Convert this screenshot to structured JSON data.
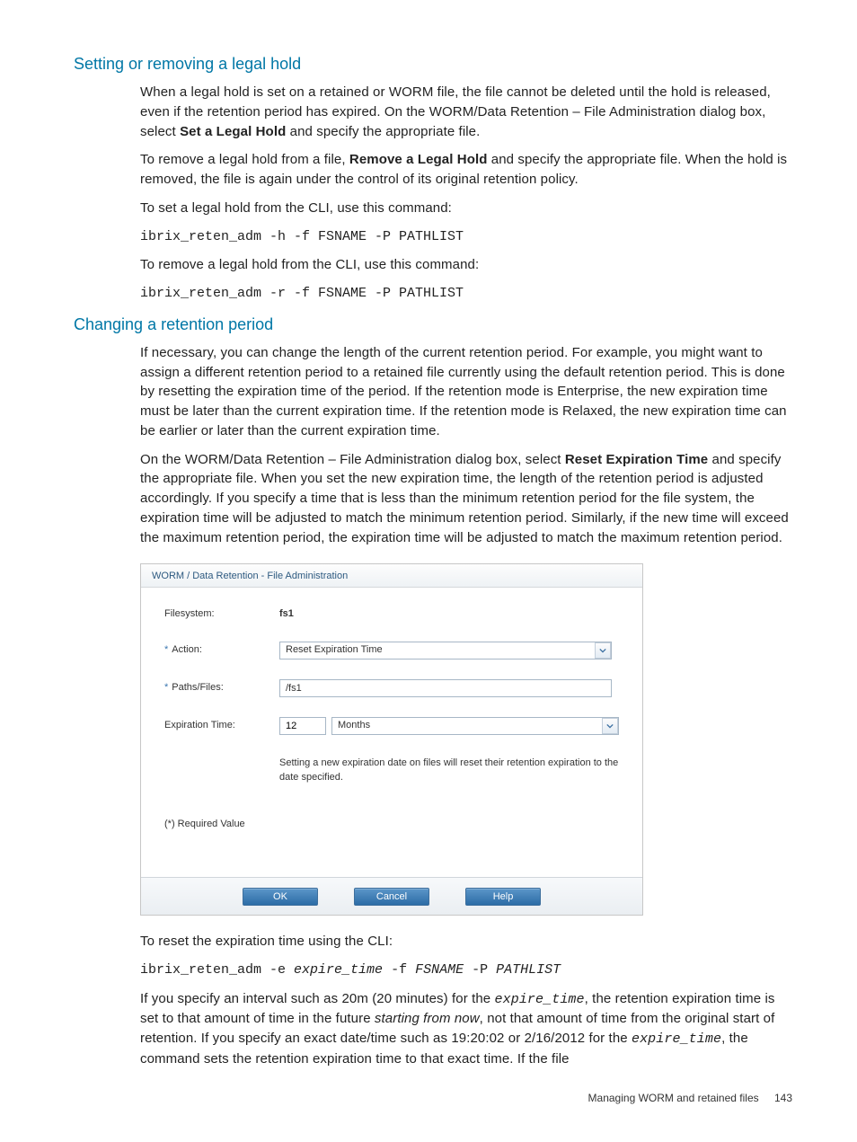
{
  "section1": {
    "heading": "Setting or removing a legal hold",
    "p1_a": "When a legal hold is set on a retained or WORM file, the file cannot be deleted until the hold is released, even if the retention period has expired. On the WORM/Data Retention – File Administration dialog box, select ",
    "p1_b": "Set a Legal Hold",
    "p1_c": " and specify the appropriate file.",
    "p2_a": "To remove a legal hold from a file, ",
    "p2_b": "Remove a Legal Hold",
    "p2_c": " and specify the appropriate file. When the hold is removed, the file is again under the control of its original retention policy.",
    "p3": "To set a legal hold from the CLI, use this command:",
    "code1": "ibrix_reten_adm -h -f FSNAME -P PATHLIST",
    "p4": "To remove a legal hold from the CLI, use this command:",
    "code2": "ibrix_reten_adm -r -f FSNAME -P PATHLIST"
  },
  "section2": {
    "heading": "Changing a retention period",
    "p1": "If necessary, you can change the length of the current retention period. For example, you might want to assign a different retention period to a retained file currently using the default retention period. This is done by resetting the expiration time of the period. If the retention mode is Enterprise, the new expiration time must be later than the current expiration time. If the retention mode is Relaxed, the new expiration time can be earlier or later than the current expiration time.",
    "p2_a": "On the WORM/Data Retention – File Administration dialog box, select ",
    "p2_b": "Reset Expiration Time",
    "p2_c": " and specify the appropriate file. When you set the new expiration time, the length of the retention period is adjusted accordingly. If you specify a time that is less than the minimum retention period for the file system, the expiration time will be adjusted to match the minimum retention period. Similarly, if the new time will exceed the maximum retention period, the expiration time will be adjusted to match the maximum retention period."
  },
  "dialog": {
    "title": "WORM / Data Retention - File Administration",
    "filesystem_label": "Filesystem:",
    "filesystem_value": "fs1",
    "action_label": "Action:",
    "action_value": "Reset Expiration Time",
    "paths_label": "Paths/Files:",
    "paths_value": "/fs1",
    "expiration_label": "Expiration Time:",
    "expiration_value": "12",
    "expiration_unit": "Months",
    "help": "Setting a new expiration date on files will reset their retention expiration to the date specified.",
    "required": "(*) Required Value",
    "ok": "OK",
    "cancel": "Cancel",
    "helpbtn": "Help"
  },
  "section3": {
    "p1": "To reset the expiration time using the CLI:",
    "code_a": "ibrix_reten_adm -e ",
    "code_b": "expire_time",
    "code_c": " -f ",
    "code_d": "FSNAME",
    "code_e": " -P ",
    "code_f": "PATHLIST",
    "p2_a": "If you specify an interval such as 20m (20 minutes) for the ",
    "p2_b": "expire_time",
    "p2_c": ", the retention expiration time is set to that amount of time in the future ",
    "p2_d": "starting from now",
    "p2_e": ", not that amount of time from the original start of retention. If you specify an exact date/time such as 19:20:02 or 2/16/2012 for the ",
    "p2_f": "expire_time",
    "p2_g": ", the command sets the retention expiration time to that exact time. If the file"
  },
  "footer": {
    "text": "Managing WORM and retained files",
    "page": "143"
  }
}
